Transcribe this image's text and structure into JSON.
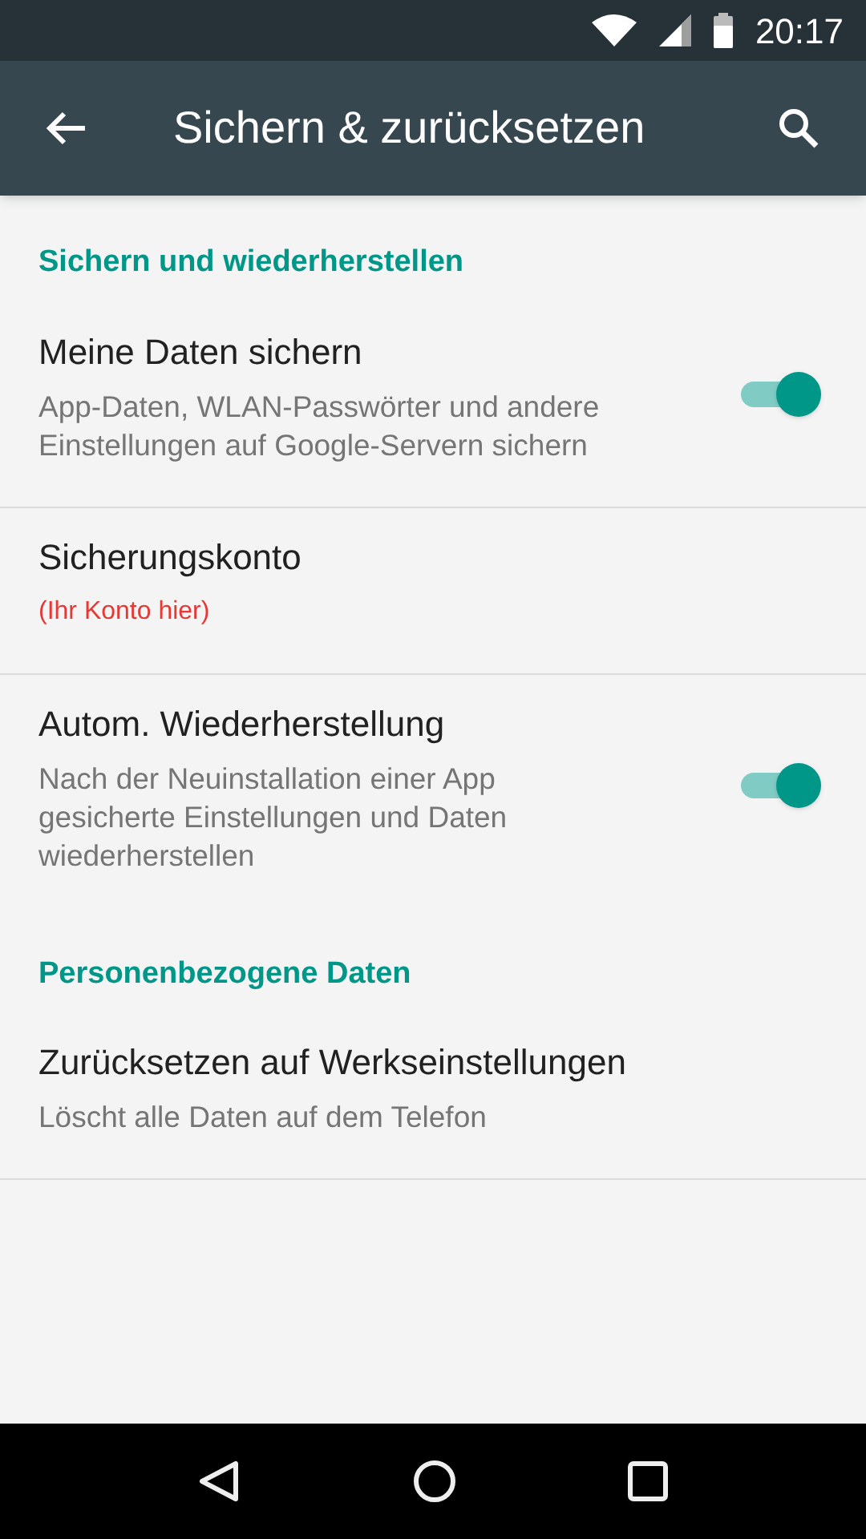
{
  "status_bar": {
    "time": "20:17"
  },
  "toolbar": {
    "title": "Sichern & zurücksetzen"
  },
  "sections": [
    {
      "title": "Sichern und wiederherstellen",
      "items": [
        {
          "kind": "toggle",
          "title": "Meine Daten sichern",
          "subtitle": "App-Daten, WLAN-Passwörter und andere Einstellungen auf Google-Servern sichern",
          "on": true
        },
        {
          "kind": "link",
          "title": "Sicherungskonto",
          "subtitle": "(Ihr Konto hier)",
          "color": "#e53935"
        },
        {
          "kind": "toggle",
          "title": "Autom. Wiederherstellung",
          "subtitle": "Nach der Neuinstallation einer App gesicherte Einstellungen und Daten wiederherstellen",
          "on": true
        }
      ]
    },
    {
      "title": "Personenbezogene Daten",
      "items": [
        {
          "kind": "link",
          "title": "Zurücksetzen auf Werkseinstellungen",
          "subtitle": "Löscht alle Daten auf dem Telefon"
        }
      ]
    }
  ]
}
